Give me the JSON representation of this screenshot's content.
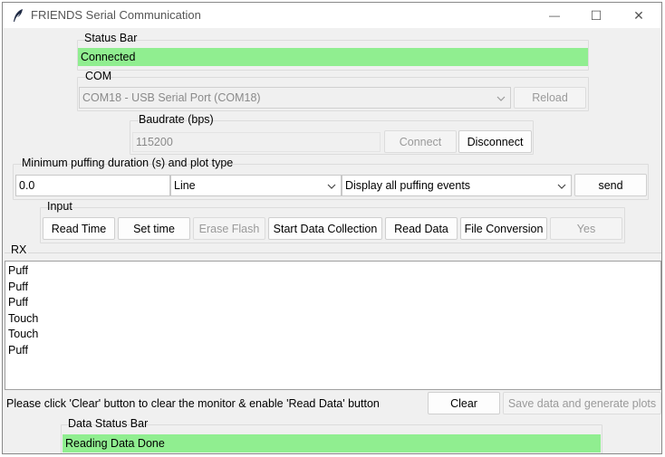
{
  "window": {
    "title": "FRIENDS Serial Communication",
    "minimize_glyph": "—",
    "maximize_glyph": "☐",
    "close_glyph": "✕"
  },
  "status_bar": {
    "label": "Status Bar",
    "value": "Connected",
    "color": "#90ee90"
  },
  "com": {
    "label": "COM",
    "selected": "COM18 - USB Serial Port (COM18)",
    "reload_label": "Reload"
  },
  "baud": {
    "label": "Baudrate (bps)",
    "value": "115200",
    "connect_label": "Connect",
    "disconnect_label": "Disconnect"
  },
  "puffing": {
    "label": "Minimum puffing duration (s) and plot type",
    "duration_value": "0.0",
    "plot_type": "Line",
    "display_mode": "Display all puffing events",
    "send_label": "send"
  },
  "input": {
    "label": "Input",
    "buttons": {
      "read_time": "Read Time",
      "set_time": "Set time",
      "erase_flash": "Erase Flash",
      "start_collection": "Start Data Collection",
      "read_data": "Read Data",
      "file_conversion": "File Conversion",
      "yes": "Yes"
    }
  },
  "rx": {
    "label": "RX",
    "lines": [
      "Puff",
      "Puff",
      "Puff",
      "Touch",
      "Touch",
      "Puff"
    ]
  },
  "footer": {
    "hint": "Please click 'Clear' button to clear the monitor & enable 'Read Data' button",
    "clear_label": "Clear",
    "save_label": "Save data and generate plots"
  },
  "data_status": {
    "label": "Data Status Bar",
    "value": "Reading Data Done",
    "color": "#90ee90"
  }
}
